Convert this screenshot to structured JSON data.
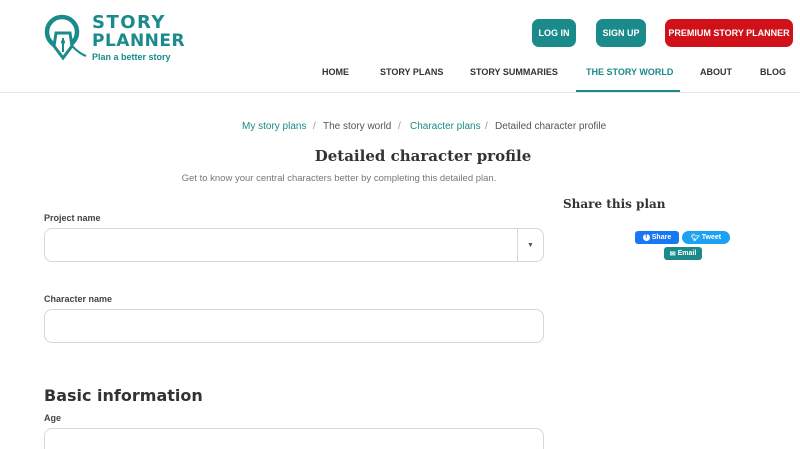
{
  "logo": {
    "line1": "STORY",
    "line2": "PLANNER",
    "tagline": "Plan a better story"
  },
  "header_buttons": {
    "login": "LOG IN",
    "signup": "SIGN UP",
    "premium": "PREMIUM STORY PLANNER"
  },
  "nav": {
    "items": [
      {
        "label": "HOME"
      },
      {
        "label": "STORY PLANS"
      },
      {
        "label": "STORY SUMMARIES"
      },
      {
        "label": "THE STORY WORLD"
      },
      {
        "label": "ABOUT"
      },
      {
        "label": "BLOG"
      }
    ],
    "active": "THE STORY WORLD"
  },
  "breadcrumb": {
    "items": [
      {
        "label": "My story plans"
      },
      {
        "label": "The story world"
      },
      {
        "label": "Character plans"
      },
      {
        "label": "Detailed character profile"
      }
    ],
    "separator": "/"
  },
  "page": {
    "title": "Detailed character profile",
    "subtitle": "Get to know your central characters better by completing this detailed plan."
  },
  "form": {
    "project_name_label": "Project name",
    "project_name_value": "",
    "character_name_label": "Character name",
    "character_name_value": "",
    "section_basic": "Basic information",
    "age_label": "Age",
    "age_value": ""
  },
  "share": {
    "title": "Share this plan",
    "facebook": "Share",
    "twitter": "Tweet",
    "email": "Email"
  },
  "colors": {
    "brand": "#1a8a8a",
    "premium": "#d0111a",
    "facebook": "#1877f2",
    "twitter": "#1da1f2"
  }
}
